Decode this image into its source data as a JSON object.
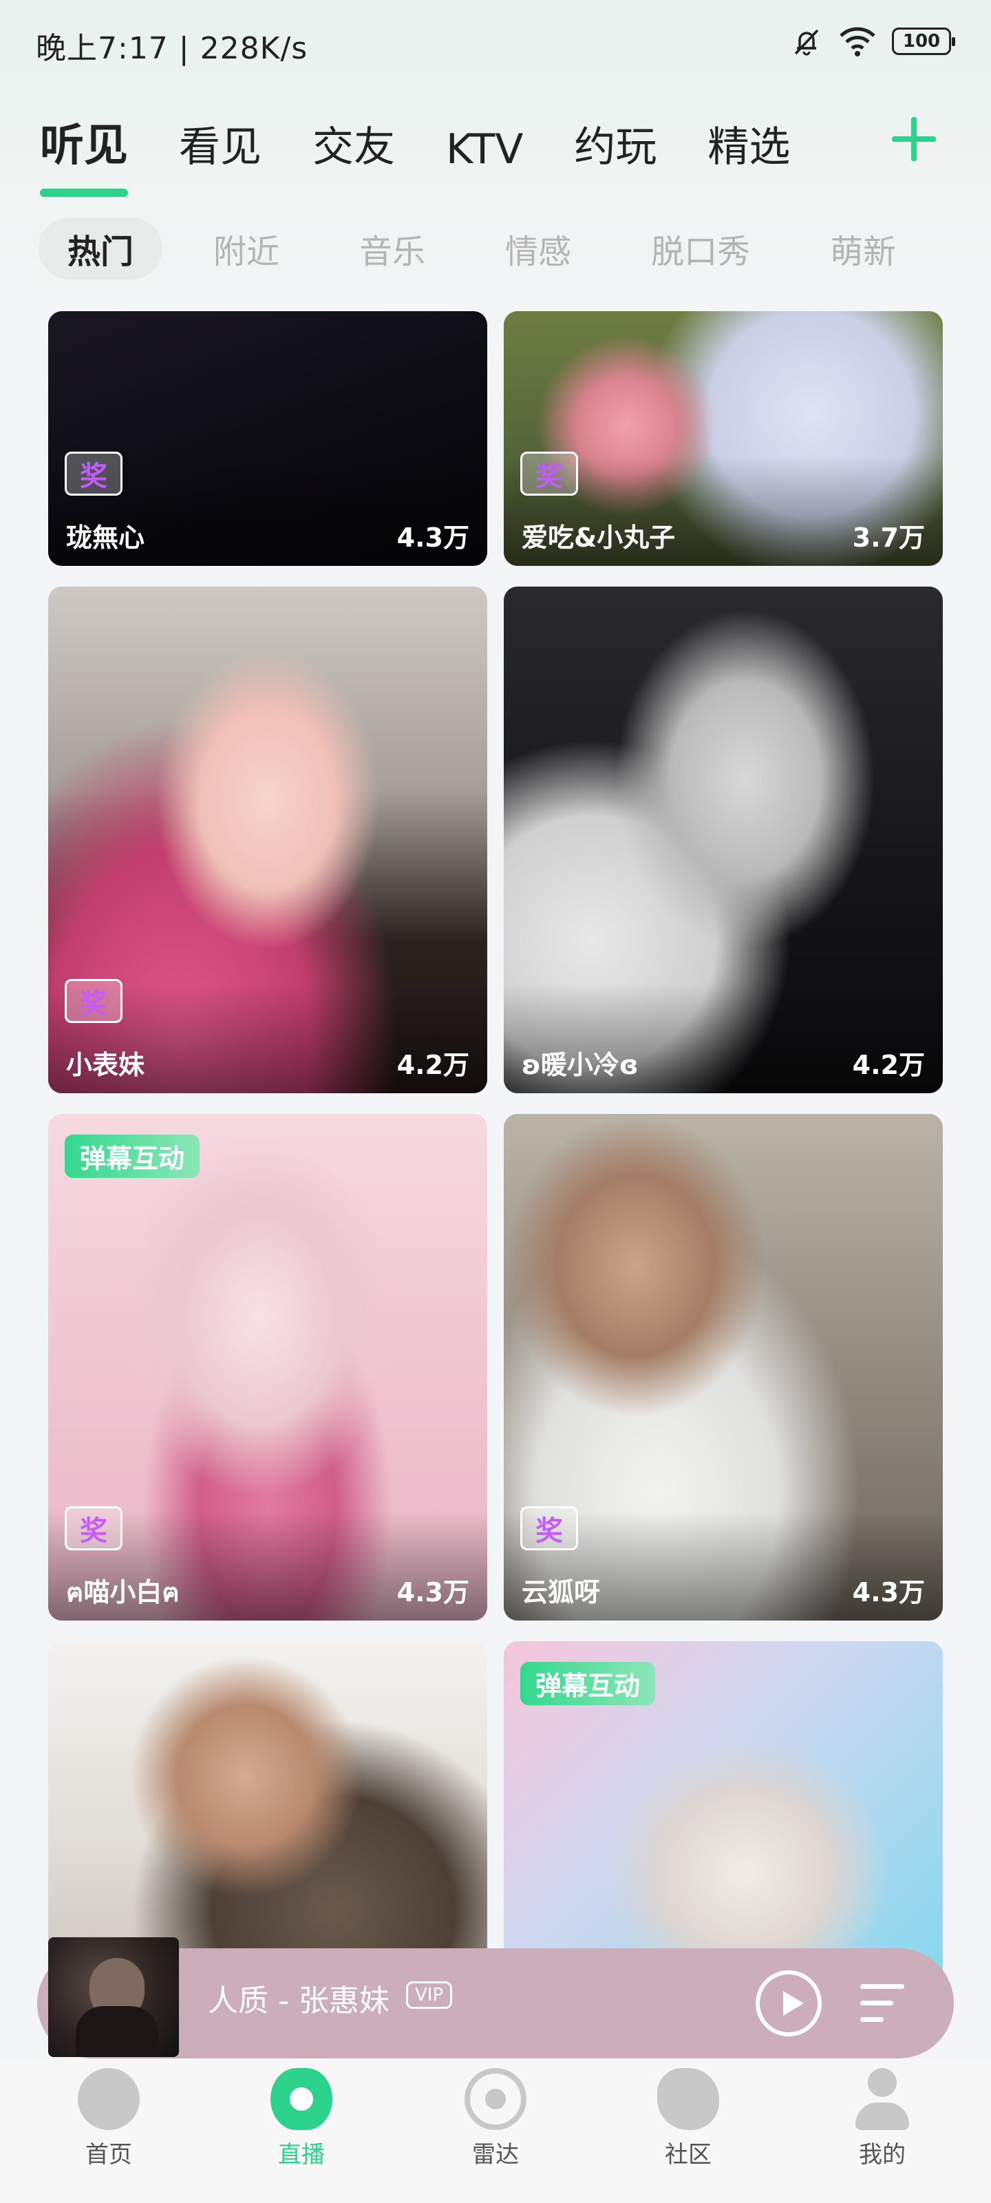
{
  "status_bar": {
    "time": "晚上7:17 | 228K/s",
    "battery": "100"
  },
  "top_tabs": [
    "听见",
    "看见",
    "交友",
    "KTV",
    "约玩",
    "精选"
  ],
  "active_top_tab": "听见",
  "sub_tabs": [
    "热门",
    "附近",
    "音乐",
    "情感",
    "脱口秀",
    "萌新"
  ],
  "active_sub_tab": "热门",
  "award_icon_text": "奖",
  "cards": [
    {
      "name": "珑無心",
      "views": "4.3万",
      "award": true,
      "tag": ""
    },
    {
      "name": "爱吃&小丸子",
      "views": "3.7万",
      "award": true,
      "tag": ""
    },
    {
      "name": "小表妹",
      "views": "4.2万",
      "award": true,
      "tag": ""
    },
    {
      "name": "ʚ暖小冷ɞ",
      "views": "4.2万",
      "award": false,
      "tag": ""
    },
    {
      "name": "ฅ喵小白ฅ",
      "views": "4.3万",
      "award": true,
      "tag": "弹幕互动"
    },
    {
      "name": "云狐呀",
      "views": "4.3万",
      "award": true,
      "tag": ""
    },
    {
      "name": "",
      "views": "",
      "award": false,
      "tag": ""
    },
    {
      "name": "",
      "views": "",
      "award": false,
      "tag": "弹幕互动"
    }
  ],
  "player": {
    "song": "人质 - 张惠妹",
    "badge": "VIP"
  },
  "bottom_nav": [
    "首页",
    "直播",
    "雷达",
    "社区",
    "我的"
  ],
  "active_bottom_nav": "直播",
  "colors": {
    "accent": "#2cd38d"
  }
}
